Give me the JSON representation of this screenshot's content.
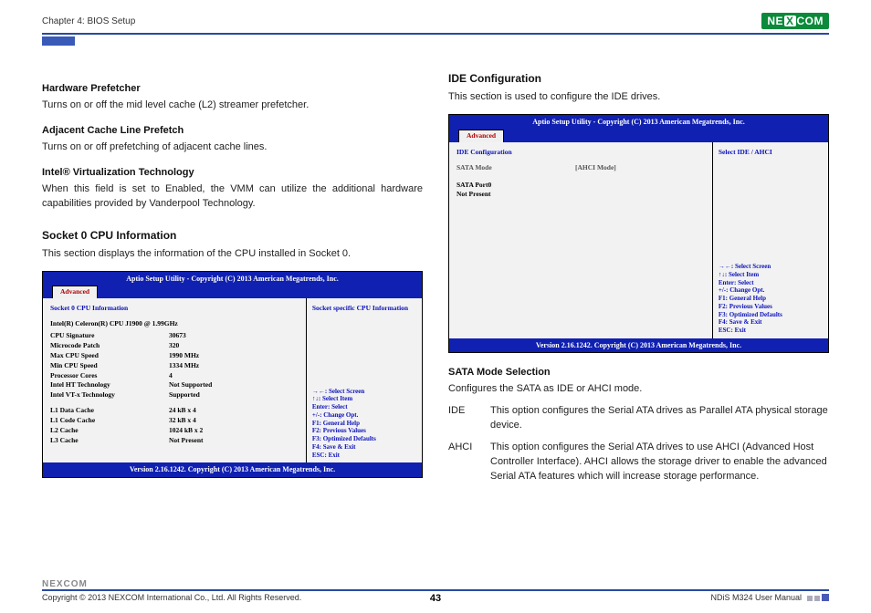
{
  "header": {
    "chapter": "Chapter 4: BIOS Setup",
    "logo_text": "NE COM",
    "logo_parts": {
      "a": "NE",
      "x": "X",
      "b": "COM"
    }
  },
  "left": {
    "h1": "Hardware Prefetcher",
    "p1": "Turns on or off the mid level cache (L2) streamer prefetcher.",
    "h2": "Adjacent Cache Line Prefetch",
    "p2": "Turns on or off prefetching of adjacent cache lines.",
    "h3": "Intel® Virtualization Technology",
    "p3": "When this field is set to Enabled, the VMM can utilize the additional hardware capabilities provided by Vanderpool Technology.",
    "h4": "Socket 0 CPU Information",
    "p4": "This section displays the information of the CPU installed in Socket 0."
  },
  "bios1": {
    "title": "Aptio Setup Utility - Copyright (C) 2013 American Megatrends, Inc.",
    "tab": "Advanced",
    "section": "Socket 0 CPU Information",
    "cpu_name": "Intel(R) Celeron(R) CPU J1900 @ 1.99GHz",
    "rows": [
      {
        "k": "CPU Signature",
        "v": "30673"
      },
      {
        "k": "Microcode Patch",
        "v": "320"
      },
      {
        "k": "Max CPU Speed",
        "v": "1990 MHz"
      },
      {
        "k": "Min CPU Speed",
        "v": "1334 MHz"
      },
      {
        "k": "Processor Cores",
        "v": "4"
      },
      {
        "k": "Intel HT Technology",
        "v": "Not Supported"
      },
      {
        "k": "Intel VT-x Technology",
        "v": "Supported"
      }
    ],
    "rows2": [
      {
        "k": "L1 Data Cache",
        "v": "24 kB x 4"
      },
      {
        "k": "L1 Code Cache",
        "v": "32 kB x 4"
      },
      {
        "k": "L2 Cache",
        "v": "1024 kB x 2"
      },
      {
        "k": "L3 Cache",
        "v": "Not Present"
      }
    ],
    "right_top": "Socket specific CPU Information",
    "help": [
      "→←: Select Screen",
      "↑↓: Select Item",
      "Enter: Select",
      "+/-: Change Opt.",
      "F1: General Help",
      "F2: Previous Values",
      "F3: Optimized Defaults",
      "F4: Save & Exit",
      "ESC: Exit"
    ],
    "footer": "Version 2.16.1242. Copyright (C) 2013 American Megatrends, Inc."
  },
  "right": {
    "h1": "IDE Configuration",
    "p1": "This section is used to configure the IDE drives.",
    "h2": "SATA Mode Selection",
    "p2": "Configures the SATA as IDE or AHCI mode.",
    "ide_label": "IDE",
    "ide_desc": "This option configures the Serial ATA drives as Parallel ATA physical storage device.",
    "ahci_label": "AHCI",
    "ahci_desc": "This option configures the Serial ATA drives to use AHCI (Advanced Host Controller Interface). AHCI allows the storage driver to enable the advanced Serial ATA features which will increase storage performance."
  },
  "bios2": {
    "title": "Aptio Setup Utility - Copyright (C) 2013 American Megatrends, Inc.",
    "tab": "Advanced",
    "section": "IDE Configuration",
    "sata_mode_k": "SATA Mode",
    "sata_mode_v": "[AHCI Mode]",
    "port0_a": "SATA Port0",
    "port0_b": "Not Present",
    "right_top": "Select IDE / AHCI",
    "help": [
      "→←: Select Screen",
      "↑↓: Select Item",
      "Enter: Select",
      "+/-: Change Opt.",
      "F1: General Help",
      "F2: Previous Values",
      "F3: Optimized Defaults",
      "F4: Save & Exit",
      "ESC: Exit"
    ],
    "footer": "Version 2.16.1242. Copyright (C) 2013 American Megatrends, Inc."
  },
  "footer": {
    "logo": "NEXCOM",
    "copyright": "Copyright © 2013 NEXCOM International Co., Ltd. All Rights Reserved.",
    "page": "43",
    "doc": "NDiS M324 User Manual"
  }
}
